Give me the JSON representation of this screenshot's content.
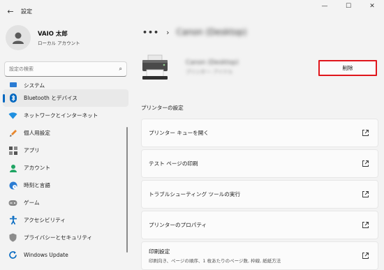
{
  "window": {
    "title": "設定",
    "back_icon": "back-arrow-icon",
    "controls": {
      "minimize": "—",
      "maximize": "☐",
      "close": "✕"
    }
  },
  "profile": {
    "name": "VAIO 太郎",
    "account_type": "ローカル アカウント"
  },
  "search": {
    "placeholder": "設定の検索"
  },
  "nav": {
    "items": [
      {
        "label": "システム",
        "icon": "system-icon"
      },
      {
        "label": "Bluetooth とデバイス",
        "icon": "bluetooth-icon",
        "selected": true
      },
      {
        "label": "ネットワークとインターネット",
        "icon": "wifi-icon"
      },
      {
        "label": "個人用設定",
        "icon": "brush-icon"
      },
      {
        "label": "アプリ",
        "icon": "apps-icon"
      },
      {
        "label": "アカウント",
        "icon": "account-icon"
      },
      {
        "label": "時刻と言語",
        "icon": "globe-clock-icon"
      },
      {
        "label": "ゲーム",
        "icon": "gamepad-icon"
      },
      {
        "label": "アクセシビリティ",
        "icon": "accessibility-icon"
      },
      {
        "label": "プライバシーとセキュリティ",
        "icon": "shield-icon"
      },
      {
        "label": "Windows Update",
        "icon": "update-icon"
      }
    ]
  },
  "breadcrumb": {
    "dots": "•••",
    "separator": "›",
    "current": "Canon (Desktop)"
  },
  "device": {
    "name": "Canon (Desktop)",
    "status": "プリンター: アイドル",
    "delete_label": "削除"
  },
  "printer_settings": {
    "section_title": "プリンターの設定",
    "rows": [
      {
        "label": "プリンター キューを開く",
        "desc": ""
      },
      {
        "label": "テスト ページの印刷",
        "desc": ""
      },
      {
        "label": "トラブルシューティング ツールの実行",
        "desc": ""
      },
      {
        "label": "プリンターのプロパティ",
        "desc": ""
      },
      {
        "label": "印刷設定",
        "desc": "印刷向き、ページの順序、1 枚あたりのページ数, 枠線, 紙紙方法"
      }
    ]
  },
  "colors": {
    "accent": "#0067c0",
    "highlight_border": "#e0161c"
  }
}
